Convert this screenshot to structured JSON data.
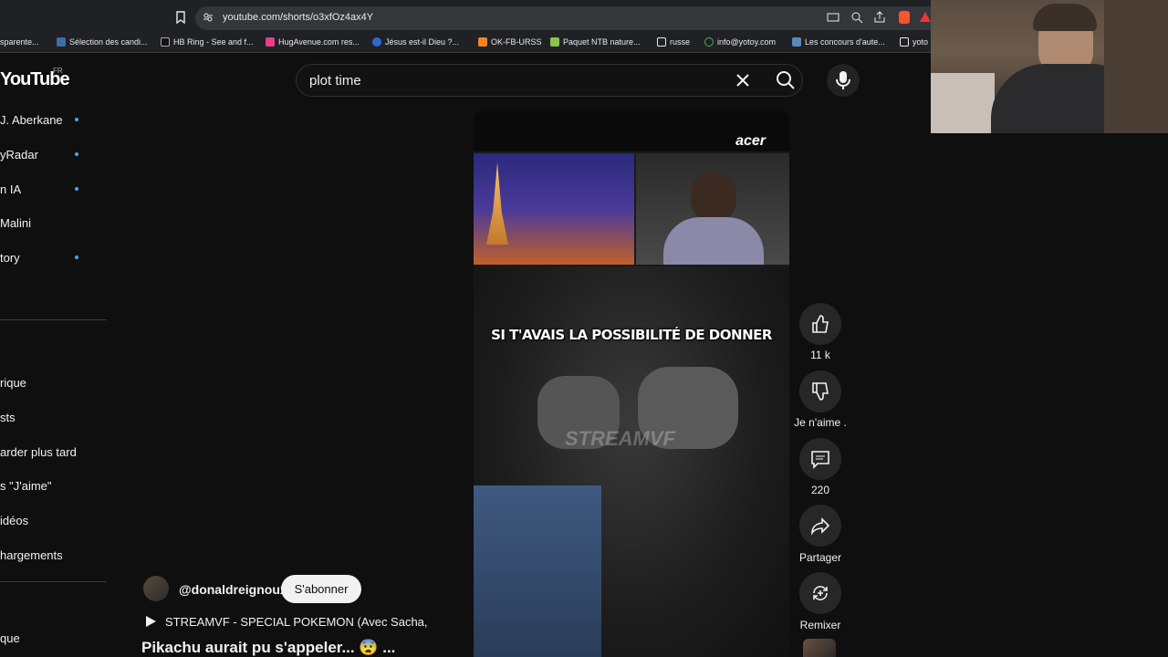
{
  "browser": {
    "url": "youtube.com/shorts/o3xfOz4ax4Y",
    "bookmarks": [
      "sparente...",
      "Sélection des candi...",
      "HB Ring - See and f...",
      "HugAvenue.com res...",
      "Jésus est-il Dieu ?...",
      "OK-FB-URSS",
      "Paquet NTB nature...",
      "russe",
      "info@yotoy.com",
      "Les concours d'aute...",
      "yoto"
    ]
  },
  "youtube": {
    "logo": "YouTube",
    "region": "FR",
    "subscriptions": [
      {
        "label": "J. Aberkane",
        "dot": true
      },
      {
        "label": "yRadar",
        "dot": true
      },
      {
        "label": "n IA",
        "dot": true
      },
      {
        "label": "Malini",
        "dot": false
      },
      {
        "label": "tory",
        "dot": true
      }
    ],
    "you_section": [
      "rique",
      "sts",
      "arder plus tard",
      "s \"J'aime\"",
      "idéos",
      "hargements"
    ],
    "bottom_item": "que"
  },
  "search": {
    "query": "plot time"
  },
  "video": {
    "brand": "acer",
    "caption": "SI T'AVAIS LA POSSIBILITÉ DE DONNER",
    "watermark": "STREAMVF"
  },
  "actions": {
    "like_count": "11 k",
    "dislike_label": "Je n'aime .",
    "comment_count": "220",
    "share_label": "Partager",
    "remix_label": "Remixer"
  },
  "channel": {
    "handle": "@donaldreignoux",
    "subscribe_label": "S'abonner"
  },
  "title": {
    "subtitle": "STREAMVF - SPECIAL POKEMON (Avec Sacha,",
    "main": "Pikachu aurait pu s'appeler... 😨 ..."
  },
  "colors": {
    "background": "#0f0f0f",
    "accent_dot": "#3ea6ff",
    "chip": "#272727"
  }
}
